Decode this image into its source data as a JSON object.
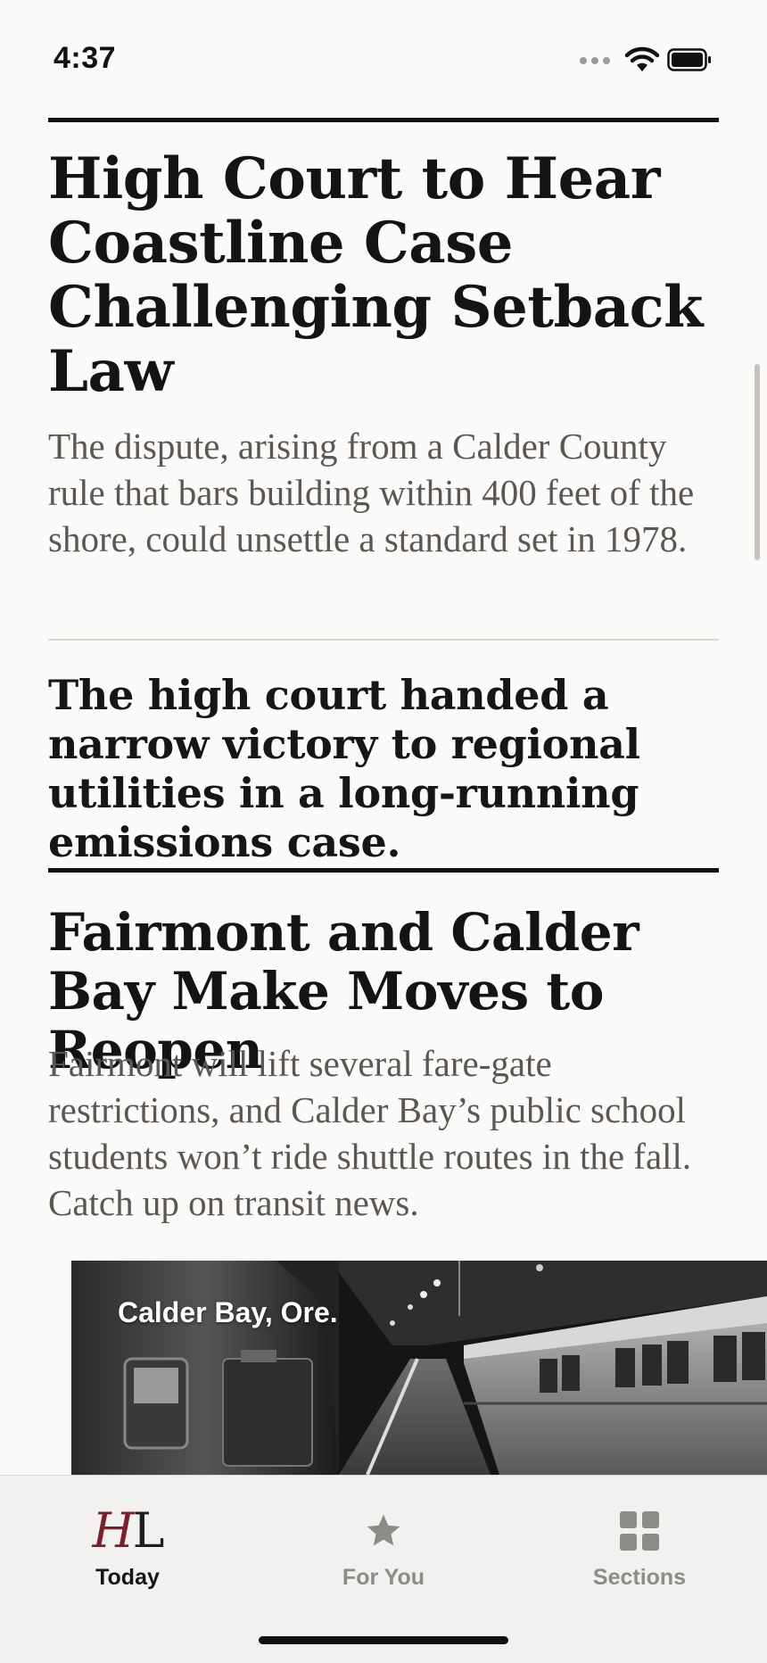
{
  "status_bar": {
    "time": "4:37"
  },
  "articles": [
    {
      "headline": "High Court to Hear Coastline Case Challenging Setback Law",
      "summary": "The dispute, arising from a Calder County rule that bars building within 400 feet of the shore, could unsettle a standard set in 1978."
    },
    {
      "headline": "The high court handed a narrow victory to regional utilities in a long-running emissions case."
    },
    {
      "headline": "Fairmont and Calder Bay Make Moves to Reopen",
      "summary": "Fairmont will lift several fare-gate restrictions, and Calder Bay’s public school students won’t ride shuttle routes in the fall. Catch up on transit news.",
      "photo_caption": "Calder Bay, Ore."
    }
  ],
  "tab_bar": {
    "tabs": [
      {
        "label": "Today",
        "icon": "hl-logo-icon",
        "selected": true
      },
      {
        "label": "For You",
        "icon": "star-icon",
        "selected": false
      },
      {
        "label": "Sections",
        "icon": "grid-icon",
        "selected": false
      }
    ],
    "logo_letters": {
      "first": "H",
      "second": "L"
    }
  },
  "colors": {
    "background": "#fbfaf8",
    "headline": "#141414",
    "summary": "#5a5754",
    "logo_accent": "#7a1f2b",
    "tab_inactive": "#8e8c89",
    "tab_bar_bg": "#f2f1ef"
  }
}
